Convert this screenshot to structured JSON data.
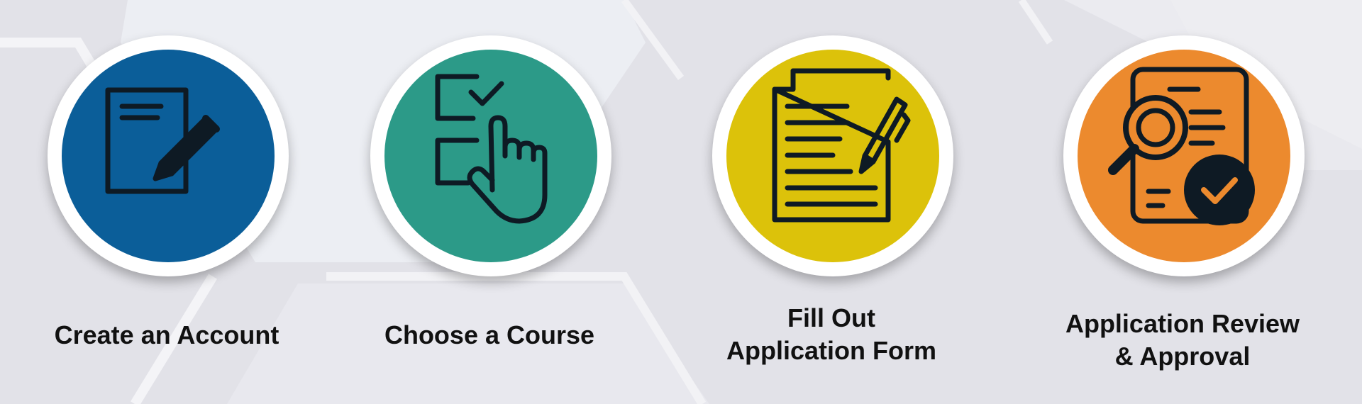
{
  "colors": {
    "background": "#e2e2e8",
    "icon_stroke": "#0e1a24",
    "ring": "#ffffff"
  },
  "steps": [
    {
      "label": "Create an Account",
      "color": "#0b5e99",
      "icon": "document-edit-icon"
    },
    {
      "label": "Choose a Course",
      "color": "#2c9a88",
      "icon": "checklist-pointer-icon"
    },
    {
      "label": "Fill Out\nApplication Form",
      "color": "#dcc20a",
      "icon": "form-pen-icon"
    },
    {
      "label": "Application Review\n& Approval",
      "color": "#ec8a2e",
      "icon": "review-approval-icon"
    }
  ]
}
